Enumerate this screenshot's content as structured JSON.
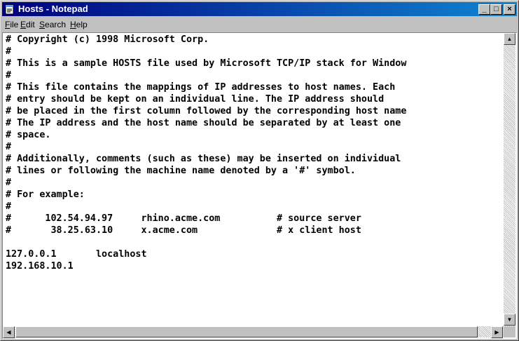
{
  "window": {
    "title": "Hosts - Notepad"
  },
  "title_buttons": {
    "minimize": "_",
    "maximize": "□",
    "close": "×"
  },
  "menu": {
    "file": {
      "key": "F",
      "rest": "ile"
    },
    "edit": {
      "key": "E",
      "rest": "dit"
    },
    "search": {
      "key": "S",
      "rest": "earch"
    },
    "help": {
      "key": "H",
      "rest": "elp"
    }
  },
  "document": {
    "lines": [
      "# Copyright (c) 1998 Microsoft Corp.",
      "#",
      "# This is a sample HOSTS file used by Microsoft TCP/IP stack for Window",
      "#",
      "# This file contains the mappings of IP addresses to host names. Each",
      "# entry should be kept on an individual line. The IP address should",
      "# be placed in the first column followed by the corresponding host name",
      "# The IP address and the host name should be separated by at least one",
      "# space.",
      "#",
      "# Additionally, comments (such as these) may be inserted on individual",
      "# lines or following the machine name denoted by a '#' symbol.",
      "#",
      "# For example:",
      "#",
      "#      102.54.94.97     rhino.acme.com          # source server",
      "#       38.25.63.10     x.acme.com              # x client host",
      "",
      "127.0.0.1       localhost",
      "192.168.10.1"
    ]
  },
  "scrollbars": {
    "up_arrow_icon": "triangle-up",
    "down_arrow_icon": "triangle-down",
    "left_arrow_icon": "triangle-left",
    "right_arrow_icon": "triangle-right"
  }
}
